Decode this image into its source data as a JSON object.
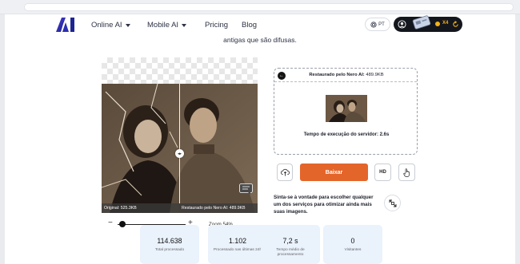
{
  "nav": {
    "items": [
      {
        "label": "Online AI",
        "dropdown": true
      },
      {
        "label": "Mobile AI",
        "dropdown": true
      },
      {
        "label": "Pricing",
        "dropdown": false
      },
      {
        "label": "Blog",
        "dropdown": false
      }
    ],
    "language": "PT",
    "credits": "X4"
  },
  "subtitle": "antigas que são difusas.",
  "compare": {
    "original_label": "Original: 525.3KB",
    "restored_label": "Restaurado pelo Nero AI: 489.9KB"
  },
  "zoom": {
    "label": "Zoom 54%",
    "minus": "−",
    "plus": "+",
    "value_percent": 54
  },
  "result": {
    "title_bold": "Restaurado pelo Nero AI:",
    "title_size": "489.9KB",
    "time": "Tempo de execução do servidor: 2.6s"
  },
  "actions": {
    "download": "Baixar",
    "hd": "HD"
  },
  "hint": "Sinta-se à vontade para escolher qualquer um dos serviços para otimizar ainda mais suas imagens.",
  "stats": [
    {
      "value": "114.638",
      "label": "Total processado"
    },
    {
      "value": "1.102",
      "label": "Processado nas últimas 24h"
    },
    {
      "value": "7,2 s",
      "label": "Tempo médio de processamento"
    },
    {
      "value": "0",
      "label": "Visitantes"
    }
  ],
  "colors": {
    "accent": "#e4652a",
    "stat_bg": "#eaf2fc",
    "logo_start": "#3b3bd4",
    "logo_end": "#1a1a8c"
  }
}
